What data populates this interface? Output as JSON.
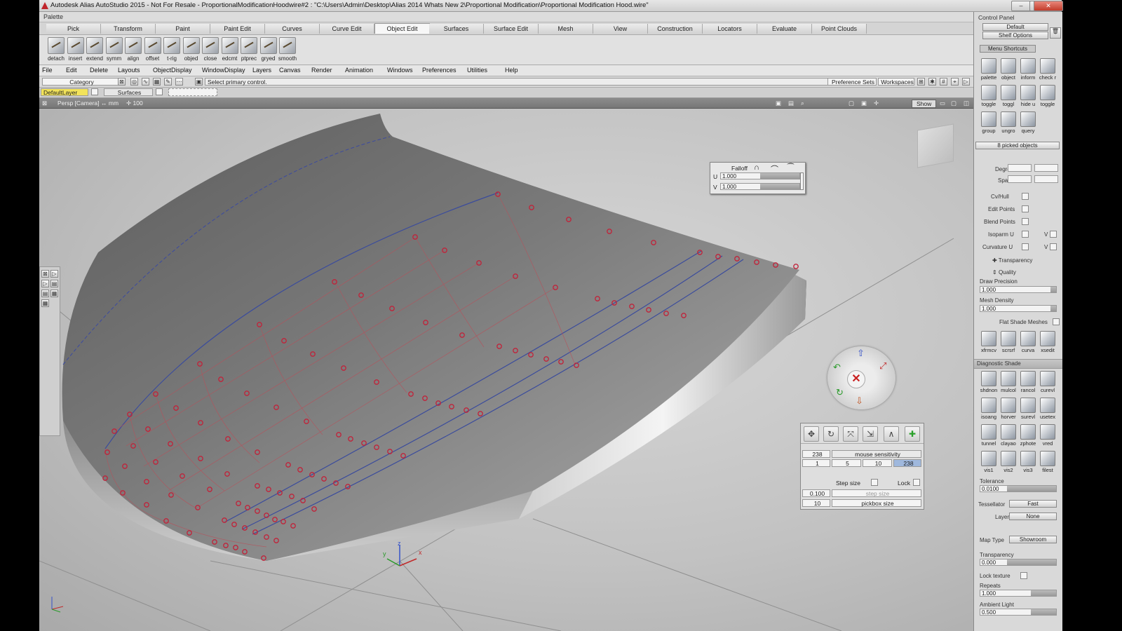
{
  "titlebar": {
    "title": "Autodesk Alias AutoStudio 2015  - Not For Resale  - ProportionalModificationHoodwire#2 : \"C:\\Users\\Admin\\Desktop\\Alias 2014 Whats New 2\\Proportional Modification\\Proportional Modification Hood.wire\"",
    "minimize": "–",
    "maximize": "□",
    "close": "✕"
  },
  "palette": {
    "title": "Palette",
    "tabs": [
      "Pick",
      "Transform",
      "Paint",
      "Paint Edit",
      "Curves",
      "Curve Edit",
      "Object Edit",
      "Surfaces",
      "Surface Edit",
      "Mesh",
      "View",
      "Construction",
      "Locators",
      "Evaluate",
      "Point Clouds"
    ],
    "active_tab": "Object Edit",
    "tools": [
      "detach",
      "insert",
      "extend",
      "symm",
      "align",
      "offset",
      "t-rig",
      "objed",
      "close",
      "edcmt",
      "ptprec",
      "gryed",
      "smooth"
    ]
  },
  "menubar": [
    "File",
    "Edit",
    "Delete",
    "Layouts",
    "ObjectDisplay",
    "WindowDisplay",
    "Layers",
    "Canvas",
    "Render",
    "Animation",
    "Windows",
    "Preferences",
    "Utilities",
    "Help"
  ],
  "controlbar": {
    "category": "Category",
    "prompt": "Select primary control.",
    "preference_sets": "Preference Sets",
    "workspaces": "Workspaces"
  },
  "layerbar": {
    "default_layer": "DefaultLayer",
    "surfaces": "Surfaces"
  },
  "viewport": {
    "label": "Persp [Camera]",
    "units": "↔ mm",
    "scale": "✛ 100",
    "show": "Show"
  },
  "falloff": {
    "title": "Falloff",
    "u_label": "U",
    "u_value": "1.000",
    "v_label": "V",
    "v_value": "1.000"
  },
  "sensitivity": {
    "value_left": "238",
    "label": "mouse sensitivity",
    "steps": [
      "1",
      "5",
      "10",
      "238"
    ],
    "step_size_label": "Step size",
    "lock_label": "Lock",
    "step_value": "0.100",
    "step_field_label": "step size",
    "pickbox_value": "10",
    "pickbox_label": "pickbox size"
  },
  "control_panel": {
    "title": "Control Panel",
    "default": "Default",
    "shelf_options": "Shelf Options",
    "menu_shortcuts": "Menu Shortcuts",
    "shortcuts": [
      "palette",
      "object",
      "inform",
      "check r",
      "toggle",
      "toggl",
      "hide u",
      "toggle",
      "group",
      "ungro",
      "query"
    ],
    "picked": "8 picked objects",
    "degree": "Degree",
    "spans": "Spans",
    "cv_hull": "Cv/Hull",
    "edit_points": "Edit Points",
    "blend_points": "Blend Points",
    "isoparm_u": "Isoparm U",
    "curvature_u": "Curvature U",
    "v": "V",
    "transparency_section": "Transparency",
    "quality_section": "Quality",
    "draw_precision": "Draw Precision",
    "draw_precision_value": "1.000",
    "mesh_density": "Mesh Density",
    "mesh_density_value": "1.000",
    "flat_shade": "Flat Shade Meshes",
    "tools2": [
      "xfrmcv",
      "scrsrf",
      "curva",
      "xsedit"
    ],
    "diagnostic_shade": "Diagnostic Shade",
    "diag": [
      "shdnon",
      "mulcol",
      "rancol",
      "curevl",
      "isoang",
      "horver",
      "surevl",
      "usetex",
      "tunnel",
      "clayao",
      "zphote",
      "vred",
      "vis1",
      "vis2",
      "vis3",
      "filest"
    ],
    "tolerance": "Tolerance",
    "tolerance_value": "0.0100",
    "tessellator": "Tessellator",
    "tessellator_value": "Fast",
    "layer": "Layer",
    "layer_value": "None",
    "map_type": "Map Type",
    "map_type_value": "Showroom",
    "transparency": "Transparency",
    "transparency_value": "0.000",
    "lock_texture": "Lock texture",
    "repeats": "Repeats",
    "repeats_value": "1.000",
    "ambient_light": "Ambient Light",
    "ambient_value": "0.500"
  },
  "axis": {
    "z": "z",
    "y": "y",
    "x": "x"
  }
}
